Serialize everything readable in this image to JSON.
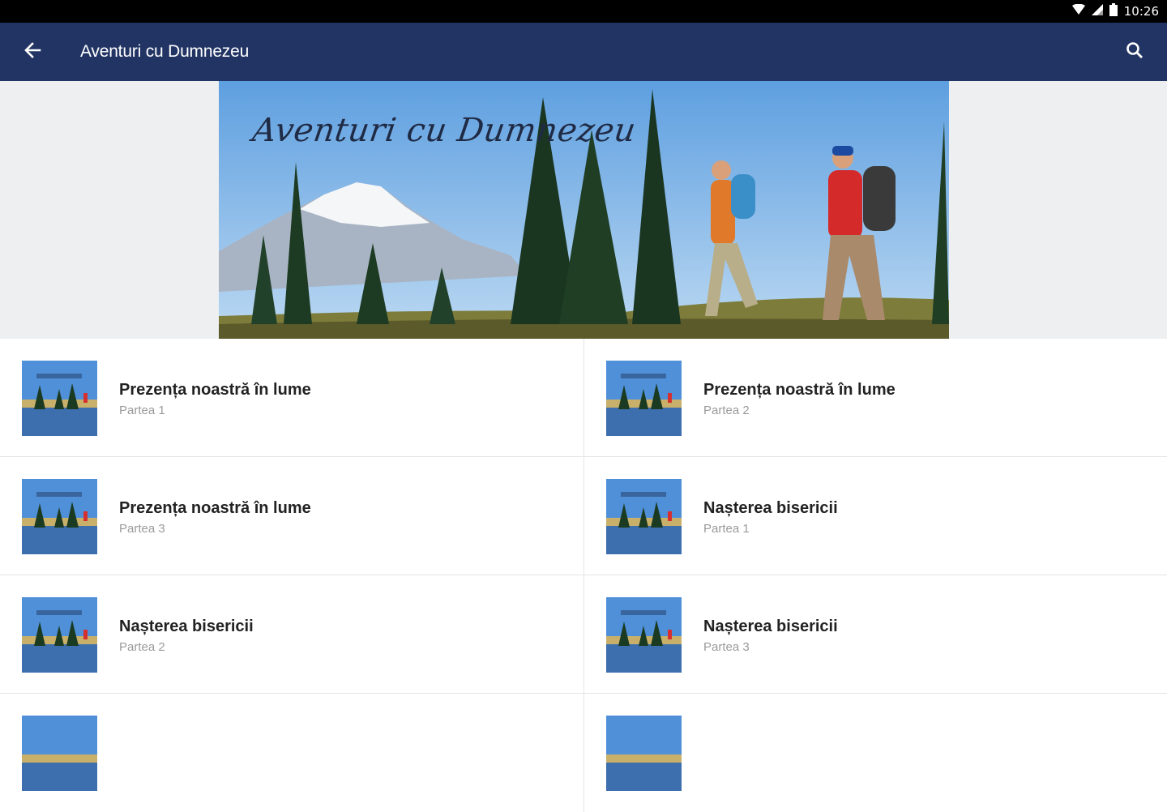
{
  "status_bar": {
    "time": "10:26",
    "icons": [
      "wifi-icon",
      "signal-icon",
      "battery-icon"
    ]
  },
  "app_bar": {
    "title": "Aventuri cu Dumnezeu",
    "back_icon": "arrow-left-icon",
    "search_icon": "search-icon",
    "color": "#213463"
  },
  "banner": {
    "caption": "Aventuri cu Dumnezeu"
  },
  "items": [
    {
      "title": "Prezența noastră în lume",
      "subtitle": "Partea 1"
    },
    {
      "title": "Prezența noastră în lume",
      "subtitle": "Partea 2"
    },
    {
      "title": "Prezența noastră în lume",
      "subtitle": "Partea 3"
    },
    {
      "title": "Nașterea bisericii",
      "subtitle": "Partea 1"
    },
    {
      "title": "Nașterea bisericii",
      "subtitle": "Partea 2"
    },
    {
      "title": "Nașterea bisericii",
      "subtitle": "Partea 3"
    },
    {
      "title": "",
      "subtitle": ""
    },
    {
      "title": "",
      "subtitle": ""
    }
  ]
}
